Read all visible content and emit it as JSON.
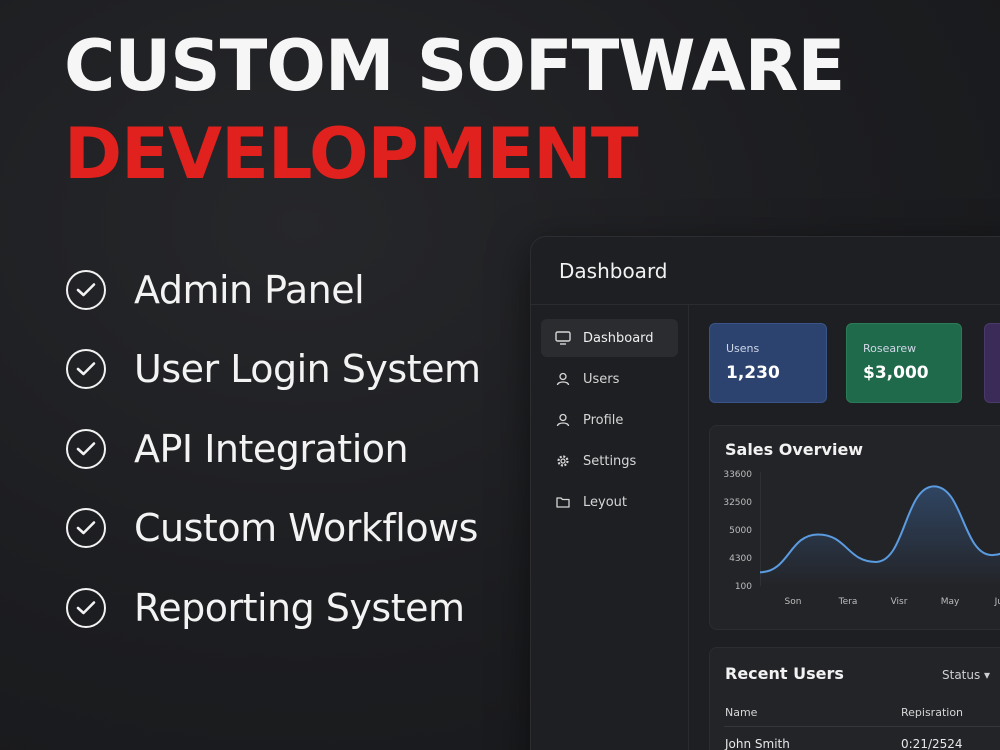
{
  "headline": {
    "line1": "CUSTOM SOFTWARE",
    "line2": "DEVELOPMENT"
  },
  "features": [
    {
      "label": "Admin Panel"
    },
    {
      "label": "User Login System"
    },
    {
      "label": "API Integration"
    },
    {
      "label": "Custom Workflows"
    },
    {
      "label": "Reporting System"
    }
  ],
  "dashboard": {
    "title": "Dashboard",
    "nav": [
      {
        "label": "Dashboard",
        "icon": "monitor-icon",
        "active": true
      },
      {
        "label": "Users",
        "icon": "user-icon"
      },
      {
        "label": "Profile",
        "icon": "user-icon"
      },
      {
        "label": "Settings",
        "icon": "gear-icon"
      },
      {
        "label": "Leyout",
        "icon": "folder-icon"
      }
    ],
    "stats": [
      {
        "label": "Usens",
        "value": "1,230",
        "color": "#2c4370"
      },
      {
        "label": "Rosearew",
        "value": "$3,000",
        "color": "#1e6a4a"
      }
    ],
    "sales": {
      "title": "Sales Overview",
      "yticks": [
        "33600",
        "32500",
        "5000",
        "4300",
        "100"
      ],
      "xticks": [
        "Son",
        "Tera",
        "Visr",
        "May",
        "Jul"
      ],
      "line_color": "#5b9be0"
    },
    "recent_users": {
      "title": "Recent Users",
      "status_label": "Status ▾",
      "columns": [
        "Name",
        "Repisration"
      ],
      "rows": [
        {
          "name": "John Smith",
          "registration": "0:21/2524"
        }
      ]
    }
  },
  "chart_data": {
    "type": "line",
    "title": "Sales Overview",
    "x": [
      "Son",
      "Tera",
      "Visr",
      "May",
      "Jul"
    ],
    "y_tick_labels": [
      "33600",
      "32500",
      "5000",
      "4300",
      "100"
    ],
    "series": [
      {
        "values": [
          0.2,
          0.75,
          0.35,
          1.45,
          0.45,
          1.0
        ]
      }
    ]
  }
}
